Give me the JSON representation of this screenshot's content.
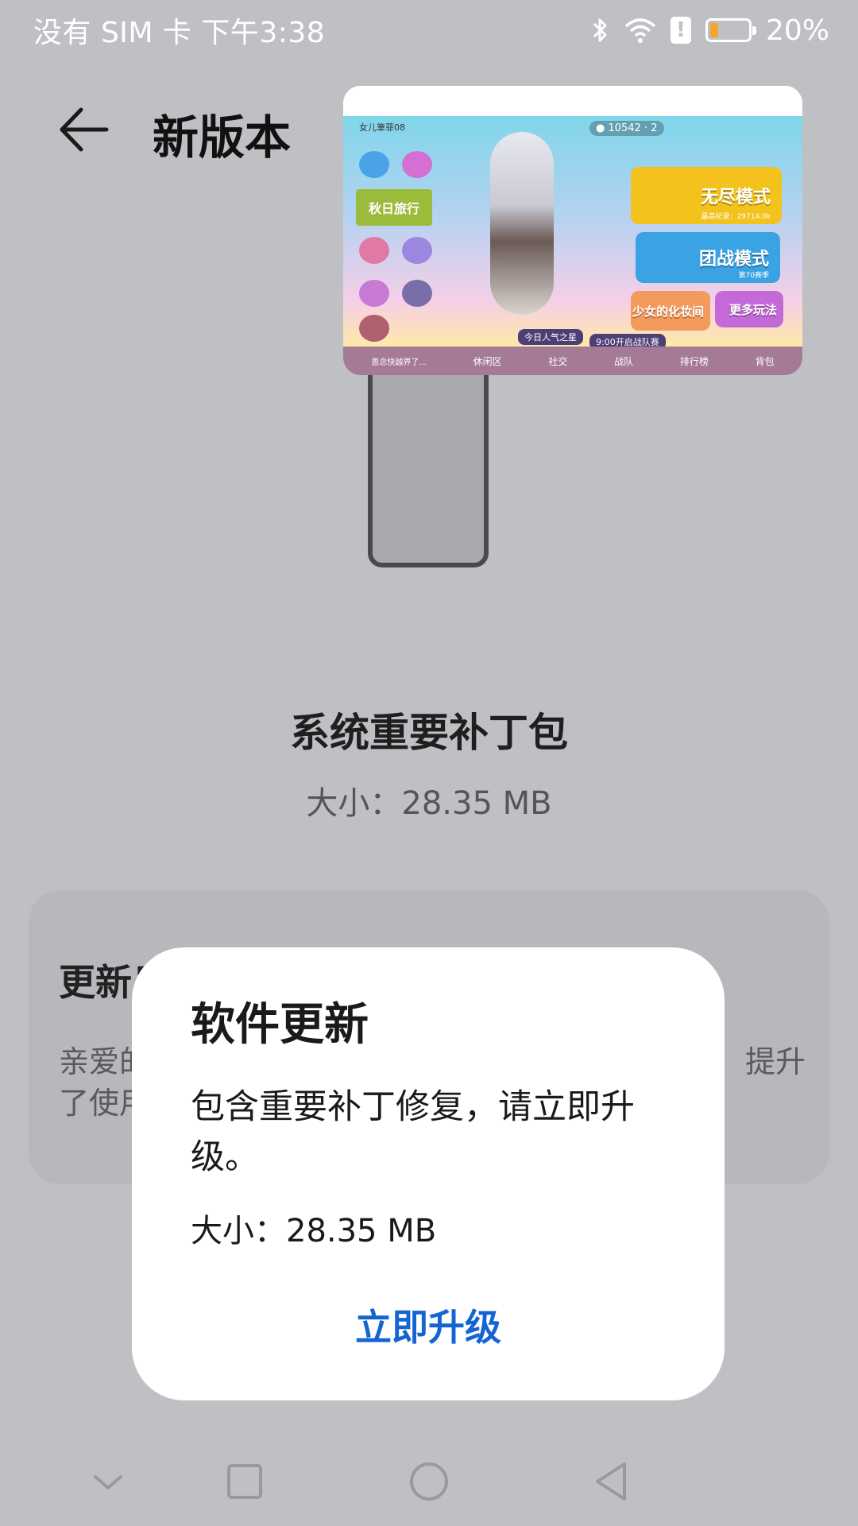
{
  "status_bar": {
    "left_text": "没有 SIM 卡 下午3:38",
    "battery_percent": "20%",
    "battery_level": 0.2,
    "alert_glyph": "!",
    "icons": [
      "bluetooth-icon",
      "wifi-icon",
      "alert-icon",
      "battery-icon"
    ]
  },
  "header": {
    "back_icon": "arrow-left-icon",
    "title": "新版本"
  },
  "illustration": {
    "user_name": "女儿筆菲08",
    "coins": "10542",
    "apples": "2",
    "autumn_banner": "秋日旅行",
    "mode_endless": "无尽模式",
    "mode_endless_sub": "最高纪录：29714.0k",
    "mode_team": "团战模式",
    "mode_team_sub": "第70赛季",
    "mode_girl": "少女的化妆间",
    "mode_more": "更多玩法",
    "popularity": "今日人气之星",
    "team_time": "9:00开启战队赛",
    "chat": "恩念快越界了...",
    "bottom_tabs": [
      "休闲区",
      "社交",
      "战队",
      "排行榜",
      "背包"
    ]
  },
  "package": {
    "title": "系统重要补丁包",
    "size": "大小：28.35 MB"
  },
  "changelog": {
    "title": "更新日",
    "text_line1": "亲爱的",
    "text_line1_end": "提升",
    "text_line2": "了使用"
  },
  "dialog": {
    "title": "软件更新",
    "message": "包含重要补丁修复，请立即升级。",
    "size": "大小：28.35 MB",
    "button": "立即升级"
  },
  "nav_bar": {
    "buttons": [
      "collapse-icon",
      "recents-icon",
      "home-icon",
      "back-icon"
    ]
  },
  "colors": {
    "background": "#bfc0c4",
    "accent": "#1564d4",
    "dialog": "#ffffff"
  }
}
